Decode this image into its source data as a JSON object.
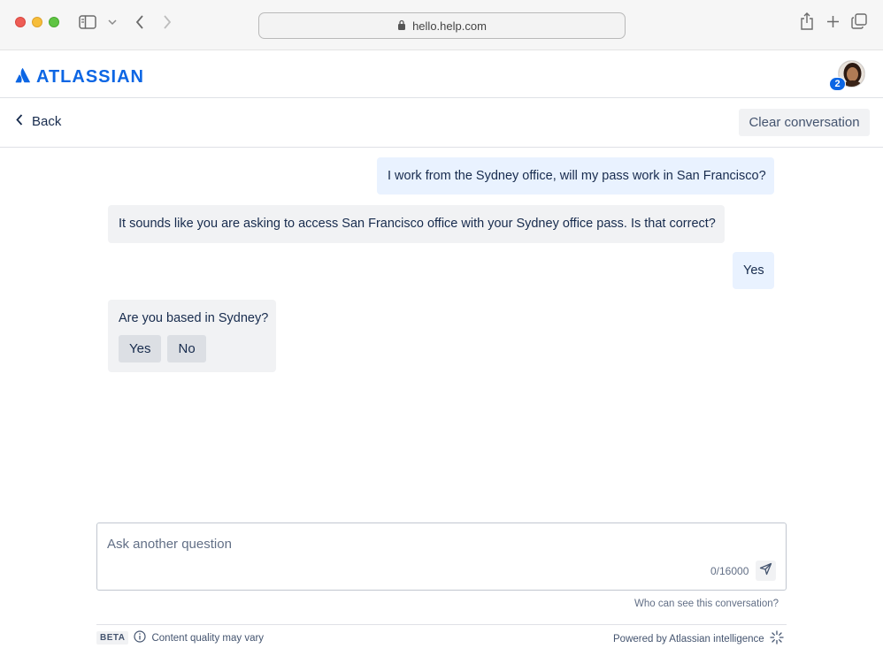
{
  "browser": {
    "url": "hello.help.com"
  },
  "header": {
    "brand": "ATLASSIAN",
    "notification_count": "2"
  },
  "subheader": {
    "back_label": "Back",
    "clear_label": "Clear conversation"
  },
  "conversation": {
    "messages": [
      {
        "from": "user",
        "text": "I work from the Sydney office, will my pass work in San Francisco?"
      },
      {
        "from": "bot",
        "text": "It sounds like you are asking to access San Francisco office with your Sydney office pass. Is that correct?"
      },
      {
        "from": "user",
        "text": "Yes"
      },
      {
        "from": "bot",
        "text": "Are you based in Sydney?",
        "options": [
          "Yes",
          "No"
        ]
      }
    ]
  },
  "composer": {
    "placeholder": "Ask another question",
    "counter": "0/16000"
  },
  "footer": {
    "who_can_see": "Who can see this conversation?",
    "beta": "BETA",
    "quality_note": "Content quality may vary",
    "powered_by": "Powered by Atlassian intelligence"
  },
  "colors": {
    "brand": "#0C66E4",
    "user_bubble": "#E9F2FF",
    "bot_bubble": "#F1F2F4"
  },
  "icons": {
    "lock": "lock-icon",
    "sidebar": "sidebar-icon",
    "share": "share-icon",
    "new_tab": "plus-icon",
    "tabs": "tabs-icon",
    "back": "chevron-left-icon",
    "send": "send-icon",
    "info": "info-icon",
    "ai": "sparkle-icon"
  }
}
